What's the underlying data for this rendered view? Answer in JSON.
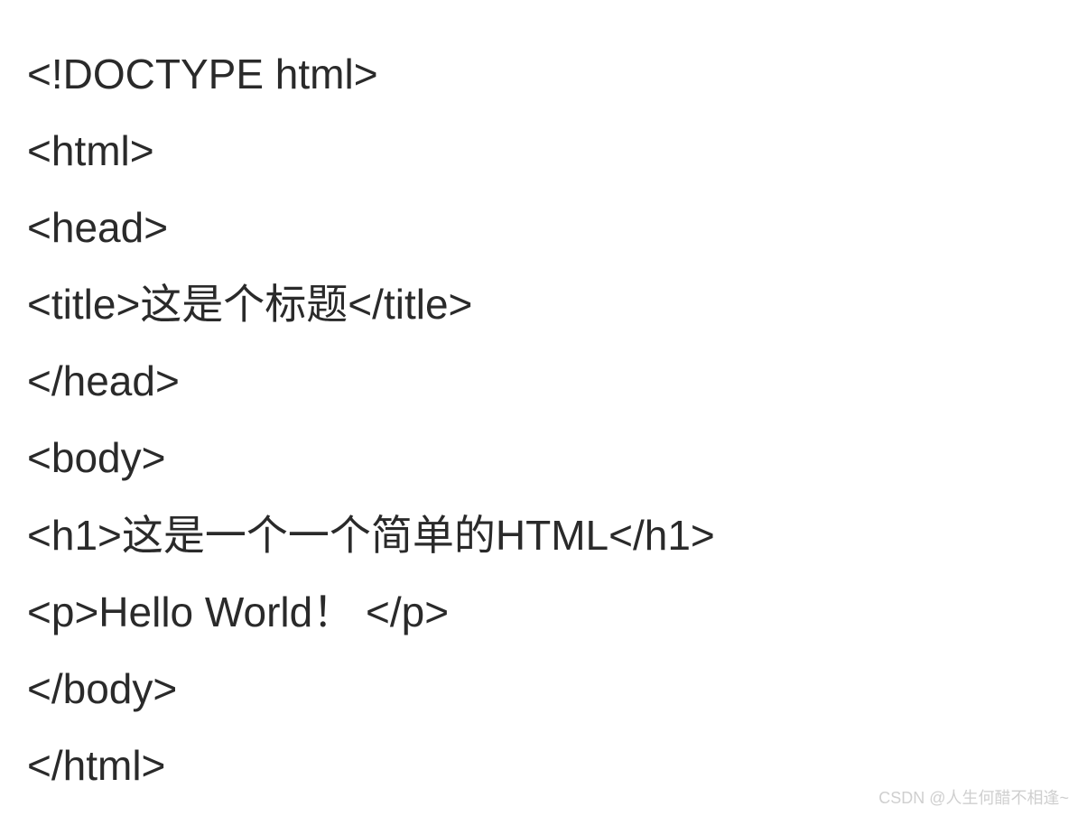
{
  "code": {
    "lines": [
      "<!DOCTYPE html>",
      "<html>",
      "<head>",
      "<title>这是个标题</title>",
      "</head>",
      "<body>",
      "<h1>这是一个一个简单的HTML</h1>",
      "<p>Hello World！ </p>",
      "</body>",
      "</html>"
    ]
  },
  "watermark": "CSDN @人生何醋不相逢~"
}
